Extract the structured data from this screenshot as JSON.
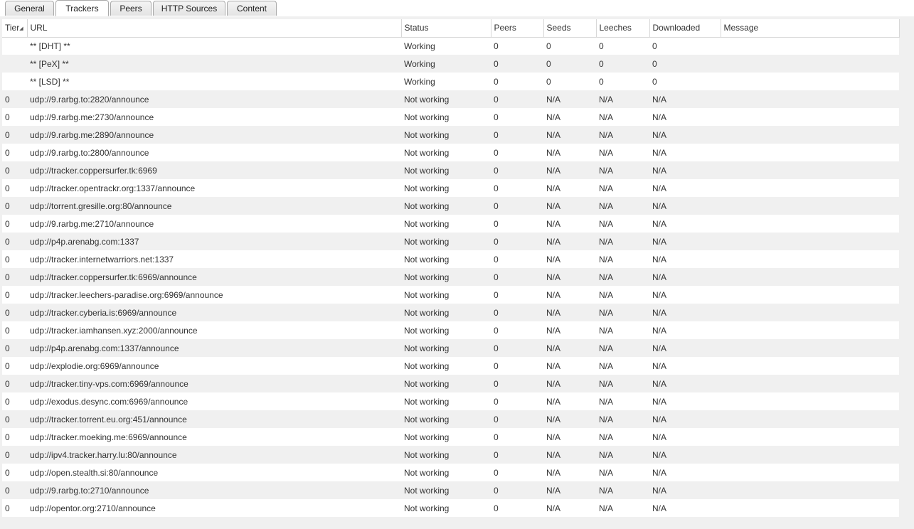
{
  "tabs": [
    {
      "label": "General"
    },
    {
      "label": "Trackers"
    },
    {
      "label": "Peers"
    },
    {
      "label": "HTTP Sources"
    },
    {
      "label": "Content"
    }
  ],
  "columns": {
    "tier": "Tier",
    "url": "URL",
    "status": "Status",
    "peers": "Peers",
    "seeds": "Seeds",
    "leeches": "Leeches",
    "downloaded": "Downloaded",
    "message": "Message"
  },
  "rows": [
    {
      "tier": "",
      "url": "** [DHT] **",
      "status": "Working",
      "peers": "0",
      "seeds": "0",
      "leeches": "0",
      "downloaded": "0",
      "message": ""
    },
    {
      "tier": "",
      "url": "** [PeX] **",
      "status": "Working",
      "peers": "0",
      "seeds": "0",
      "leeches": "0",
      "downloaded": "0",
      "message": ""
    },
    {
      "tier": "",
      "url": "** [LSD] **",
      "status": "Working",
      "peers": "0",
      "seeds": "0",
      "leeches": "0",
      "downloaded": "0",
      "message": ""
    },
    {
      "tier": "0",
      "url": "udp://9.rarbg.to:2820/announce",
      "status": "Not working",
      "peers": "0",
      "seeds": "N/A",
      "leeches": "N/A",
      "downloaded": "N/A",
      "message": ""
    },
    {
      "tier": "0",
      "url": "udp://9.rarbg.me:2730/announce",
      "status": "Not working",
      "peers": "0",
      "seeds": "N/A",
      "leeches": "N/A",
      "downloaded": "N/A",
      "message": ""
    },
    {
      "tier": "0",
      "url": "udp://9.rarbg.me:2890/announce",
      "status": "Not working",
      "peers": "0",
      "seeds": "N/A",
      "leeches": "N/A",
      "downloaded": "N/A",
      "message": ""
    },
    {
      "tier": "0",
      "url": "udp://9.rarbg.to:2800/announce",
      "status": "Not working",
      "peers": "0",
      "seeds": "N/A",
      "leeches": "N/A",
      "downloaded": "N/A",
      "message": ""
    },
    {
      "tier": "0",
      "url": "udp://tracker.coppersurfer.tk:6969",
      "status": "Not working",
      "peers": "0",
      "seeds": "N/A",
      "leeches": "N/A",
      "downloaded": "N/A",
      "message": ""
    },
    {
      "tier": "0",
      "url": "udp://tracker.opentrackr.org:1337/announce",
      "status": "Not working",
      "peers": "0",
      "seeds": "N/A",
      "leeches": "N/A",
      "downloaded": "N/A",
      "message": ""
    },
    {
      "tier": "0",
      "url": "udp://torrent.gresille.org:80/announce",
      "status": "Not working",
      "peers": "0",
      "seeds": "N/A",
      "leeches": "N/A",
      "downloaded": "N/A",
      "message": ""
    },
    {
      "tier": "0",
      "url": "udp://9.rarbg.me:2710/announce",
      "status": "Not working",
      "peers": "0",
      "seeds": "N/A",
      "leeches": "N/A",
      "downloaded": "N/A",
      "message": ""
    },
    {
      "tier": "0",
      "url": "udp://p4p.arenabg.com:1337",
      "status": "Not working",
      "peers": "0",
      "seeds": "N/A",
      "leeches": "N/A",
      "downloaded": "N/A",
      "message": ""
    },
    {
      "tier": "0",
      "url": "udp://tracker.internetwarriors.net:1337",
      "status": "Not working",
      "peers": "0",
      "seeds": "N/A",
      "leeches": "N/A",
      "downloaded": "N/A",
      "message": ""
    },
    {
      "tier": "0",
      "url": "udp://tracker.coppersurfer.tk:6969/announce",
      "status": "Not working",
      "peers": "0",
      "seeds": "N/A",
      "leeches": "N/A",
      "downloaded": "N/A",
      "message": ""
    },
    {
      "tier": "0",
      "url": "udp://tracker.leechers-paradise.org:6969/announce",
      "status": "Not working",
      "peers": "0",
      "seeds": "N/A",
      "leeches": "N/A",
      "downloaded": "N/A",
      "message": ""
    },
    {
      "tier": "0",
      "url": "udp://tracker.cyberia.is:6969/announce",
      "status": "Not working",
      "peers": "0",
      "seeds": "N/A",
      "leeches": "N/A",
      "downloaded": "N/A",
      "message": ""
    },
    {
      "tier": "0",
      "url": "udp://tracker.iamhansen.xyz:2000/announce",
      "status": "Not working",
      "peers": "0",
      "seeds": "N/A",
      "leeches": "N/A",
      "downloaded": "N/A",
      "message": ""
    },
    {
      "tier": "0",
      "url": "udp://p4p.arenabg.com:1337/announce",
      "status": "Not working",
      "peers": "0",
      "seeds": "N/A",
      "leeches": "N/A",
      "downloaded": "N/A",
      "message": ""
    },
    {
      "tier": "0",
      "url": "udp://explodie.org:6969/announce",
      "status": "Not working",
      "peers": "0",
      "seeds": "N/A",
      "leeches": "N/A",
      "downloaded": "N/A",
      "message": ""
    },
    {
      "tier": "0",
      "url": "udp://tracker.tiny-vps.com:6969/announce",
      "status": "Not working",
      "peers": "0",
      "seeds": "N/A",
      "leeches": "N/A",
      "downloaded": "N/A",
      "message": ""
    },
    {
      "tier": "0",
      "url": "udp://exodus.desync.com:6969/announce",
      "status": "Not working",
      "peers": "0",
      "seeds": "N/A",
      "leeches": "N/A",
      "downloaded": "N/A",
      "message": ""
    },
    {
      "tier": "0",
      "url": "udp://tracker.torrent.eu.org:451/announce",
      "status": "Not working",
      "peers": "0",
      "seeds": "N/A",
      "leeches": "N/A",
      "downloaded": "N/A",
      "message": ""
    },
    {
      "tier": "0",
      "url": "udp://tracker.moeking.me:6969/announce",
      "status": "Not working",
      "peers": "0",
      "seeds": "N/A",
      "leeches": "N/A",
      "downloaded": "N/A",
      "message": ""
    },
    {
      "tier": "0",
      "url": "udp://ipv4.tracker.harry.lu:80/announce",
      "status": "Not working",
      "peers": "0",
      "seeds": "N/A",
      "leeches": "N/A",
      "downloaded": "N/A",
      "message": ""
    },
    {
      "tier": "0",
      "url": "udp://open.stealth.si:80/announce",
      "status": "Not working",
      "peers": "0",
      "seeds": "N/A",
      "leeches": "N/A",
      "downloaded": "N/A",
      "message": ""
    },
    {
      "tier": "0",
      "url": "udp://9.rarbg.to:2710/announce",
      "status": "Not working",
      "peers": "0",
      "seeds": "N/A",
      "leeches": "N/A",
      "downloaded": "N/A",
      "message": ""
    },
    {
      "tier": "0",
      "url": "udp://opentor.org:2710/announce",
      "status": "Not working",
      "peers": "0",
      "seeds": "N/A",
      "leeches": "N/A",
      "downloaded": "N/A",
      "message": ""
    }
  ]
}
